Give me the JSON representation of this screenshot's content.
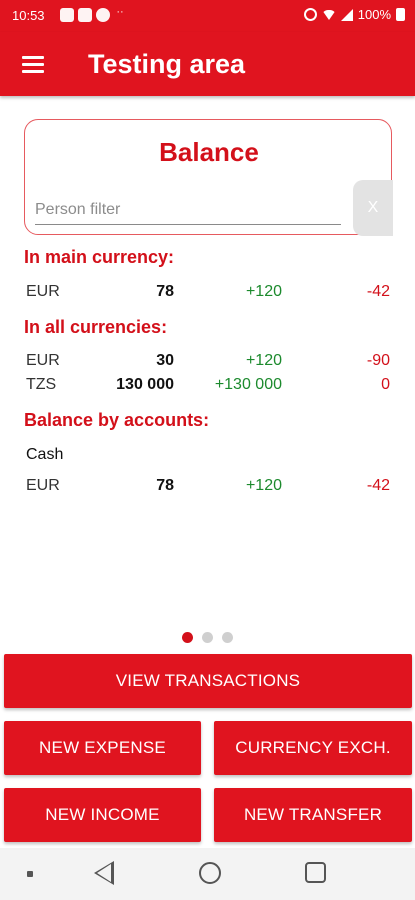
{
  "status_bar": {
    "time": "10:53",
    "battery": "100%",
    "notification_icons": [
      "messages-icon",
      "youtube-icon",
      "app-icon",
      "more-icon"
    ],
    "right_icons": [
      "alarm-icon",
      "wifi-icon",
      "signal-icon",
      "battery-icon"
    ]
  },
  "app_bar": {
    "title": "Testing area",
    "menu_icon": "menu-icon"
  },
  "balance": {
    "title": "Balance",
    "person_filter_placeholder": "Person filter",
    "clear_label": "X"
  },
  "main_currency": {
    "header": "In main currency:",
    "rows": [
      {
        "currency": "EUR",
        "amount": "78",
        "income": "+120",
        "expense": "-42"
      }
    ]
  },
  "all_currencies": {
    "header": "In all currencies:",
    "rows": [
      {
        "currency": "EUR",
        "amount": "30",
        "income": "+120",
        "expense": "-90"
      },
      {
        "currency": "TZS",
        "amount": "130 000",
        "income": "+130 000",
        "expense": "0"
      }
    ]
  },
  "by_accounts": {
    "header": "Balance by accounts:",
    "accounts": [
      {
        "name": "Cash",
        "rows": [
          {
            "currency": "EUR",
            "amount": "78",
            "income": "+120",
            "expense": "-42"
          }
        ]
      }
    ]
  },
  "pager": {
    "pages": 3,
    "active": 0
  },
  "buttons": {
    "view_transactions": "VIEW TRANSACTIONS",
    "new_expense": "NEW EXPENSE",
    "currency_exchange": "CURRENCY EXCH.",
    "new_income": "NEW INCOME",
    "new_transfer": "NEW TRANSFER"
  },
  "colors": {
    "primary": "#e0141f",
    "accent_text": "#d3101a",
    "income": "#1c8a2d",
    "expense": "#d3101a"
  }
}
